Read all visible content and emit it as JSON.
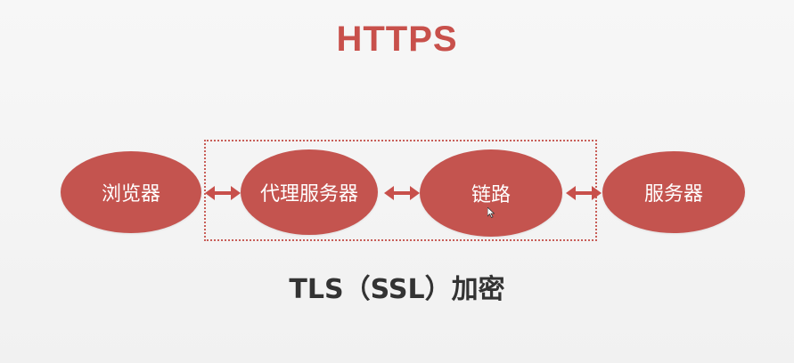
{
  "slide": {
    "title": "HTTPS",
    "subtitle": "TLS（SSL）加密"
  },
  "nodes": {
    "browser": "浏览器",
    "proxy": "代理服务器",
    "link": "链路",
    "server": "服务器"
  },
  "colors": {
    "accent": "#c8504b",
    "node_fill": "#c4544f",
    "title_text": "#c8504b",
    "subtitle_text": "#333333",
    "node_text": "#ffffff",
    "dotted_border": "#c85e58",
    "background": "#f4f4f4"
  },
  "icons": {
    "arrows": "double-arrow-icon",
    "pointer": "mouse-pointer-icon"
  }
}
